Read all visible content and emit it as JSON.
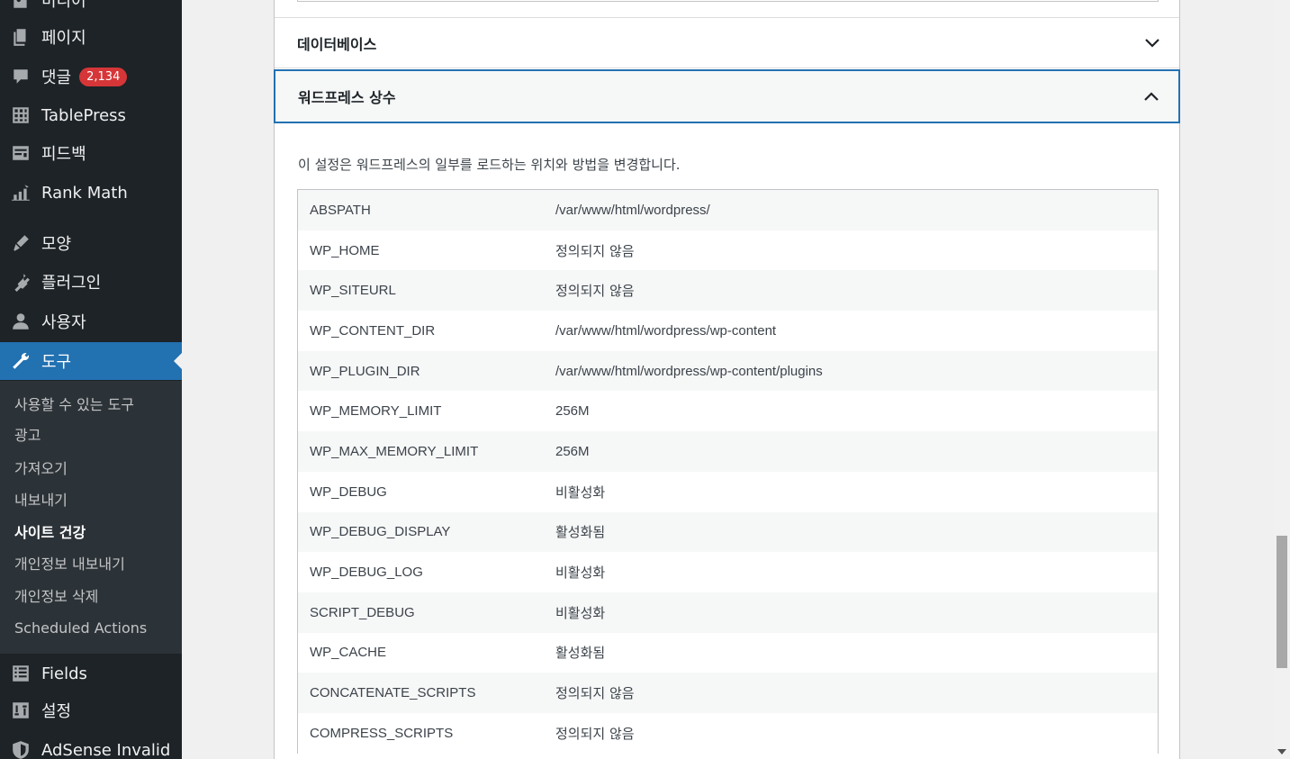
{
  "sidebar": {
    "menu": [
      {
        "label": "미디어",
        "icon": "media-icon"
      },
      {
        "label": "페이지",
        "icon": "pages-icon"
      },
      {
        "label": "댓글",
        "icon": "comments-icon",
        "badge": "2,134"
      },
      {
        "label": "TablePress",
        "icon": "tablepress-icon"
      },
      {
        "label": "피드백",
        "icon": "feedback-icon"
      },
      {
        "label": "Rank Math",
        "icon": "rank-math-icon"
      },
      {
        "label": "모양",
        "icon": "appearance-icon"
      },
      {
        "label": "플러그인",
        "icon": "plugins-icon"
      },
      {
        "label": "사용자",
        "icon": "users-icon"
      },
      {
        "label": "도구",
        "icon": "tools-icon",
        "active": true
      },
      {
        "label": "Fields",
        "icon": "fields-icon"
      },
      {
        "label": "설정",
        "icon": "settings-icon"
      },
      {
        "label": "AdSense Invalid",
        "icon": "shield-icon"
      }
    ],
    "submenu": [
      "사용할 수 있는 도구",
      "광고",
      "가져오기",
      "내보내기",
      "사이트 건강",
      "개인정보 내보내기",
      "개인정보 삭제",
      "Scheduled Actions"
    ],
    "submenu_current": "사이트 건강"
  },
  "accordion": {
    "database_title": "데이터베이스",
    "constants_title": "워드프레스 상수",
    "constants_description": "이 설정은 워드프레스의 일부를 로드하는 위치와 방법을 변경합니다."
  },
  "constants": [
    {
      "name": "ABSPATH",
      "value": "/var/www/html/wordpress/"
    },
    {
      "name": "WP_HOME",
      "value": "정의되지 않음"
    },
    {
      "name": "WP_SITEURL",
      "value": "정의되지 않음"
    },
    {
      "name": "WP_CONTENT_DIR",
      "value": "/var/www/html/wordpress/wp-content"
    },
    {
      "name": "WP_PLUGIN_DIR",
      "value": "/var/www/html/wordpress/wp-content/plugins"
    },
    {
      "name": "WP_MEMORY_LIMIT",
      "value": "256M"
    },
    {
      "name": "WP_MAX_MEMORY_LIMIT",
      "value": "256M"
    },
    {
      "name": "WP_DEBUG",
      "value": "비활성화"
    },
    {
      "name": "WP_DEBUG_DISPLAY",
      "value": "활성화됨"
    },
    {
      "name": "WP_DEBUG_LOG",
      "value": "비활성화"
    },
    {
      "name": "SCRIPT_DEBUG",
      "value": "비활성화"
    },
    {
      "name": "WP_CACHE",
      "value": "활성화됨"
    },
    {
      "name": "CONCATENATE_SCRIPTS",
      "value": "정의되지 않음"
    },
    {
      "name": "COMPRESS_SCRIPTS",
      "value": "정의되지 않음"
    }
  ],
  "colors": {
    "sidebar_bg": "#1d2327",
    "submenu_bg": "#2c3338",
    "accent": "#2271b1",
    "badge": "#d63638"
  }
}
